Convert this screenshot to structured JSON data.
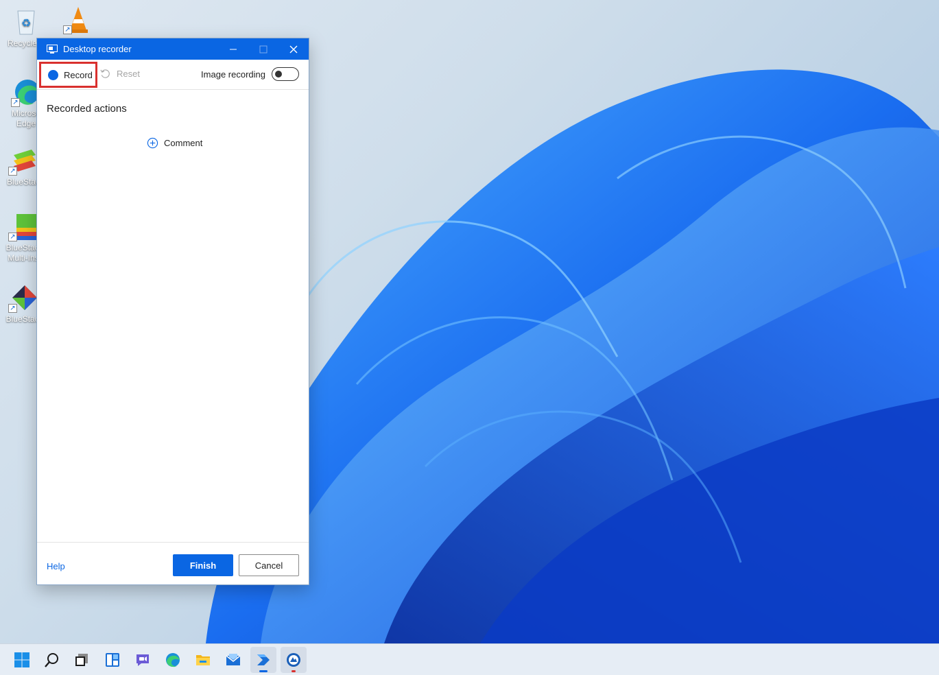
{
  "desktop": {
    "icons": [
      {
        "label": "Recycle B",
        "icon": "recycle-bin-icon"
      },
      {
        "label": "",
        "icon": "vlc-icon"
      },
      {
        "label": "Microso Edge",
        "icon": "edge-icon"
      },
      {
        "label": "BlueStac",
        "icon": "bluestacks-icon"
      },
      {
        "label": "BlueStaci Multi-Ins",
        "icon": "bluestacks-multi-instance-icon"
      },
      {
        "label": "BlueStaci",
        "icon": "bluestacks-x-icon"
      }
    ]
  },
  "window": {
    "title": "Desktop recorder",
    "toolbar": {
      "record_label": "Record",
      "reset_label": "Reset",
      "image_recording_label": "Image recording",
      "image_recording_on": false
    },
    "section_title": "Recorded actions",
    "comment_label": "Comment",
    "footer": {
      "help_label": "Help",
      "finish_label": "Finish",
      "cancel_label": "Cancel"
    }
  },
  "taskbar": {
    "items": [
      "start-icon",
      "search-icon",
      "task-view-icon",
      "widgets-icon",
      "chat-icon",
      "edge-icon",
      "file-explorer-icon",
      "mail-icon",
      "power-automate-icon",
      "desktop-recorder-icon"
    ]
  },
  "colors": {
    "accent": "#0a66e3",
    "highlight_border": "#d9302e"
  }
}
